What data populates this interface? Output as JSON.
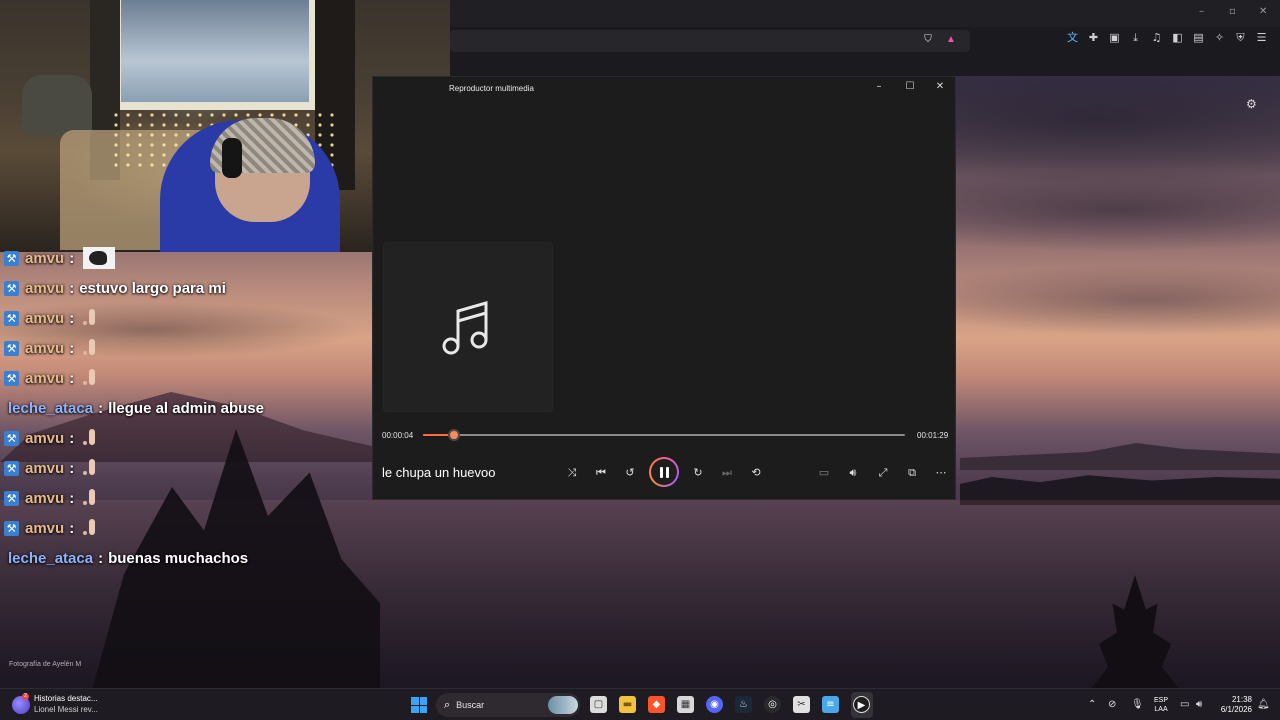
{
  "player": {
    "title": "Reproductor multimedia",
    "song_title": "le chupa un huevoo",
    "time_current": "00:00:04",
    "time_total": "00:01:29",
    "progress_fraction": 0.065,
    "controls": {
      "minimize": "–",
      "maximize": "☐",
      "close": "✕"
    }
  },
  "chat": {
    "messages": [
      {
        "user": "amvu",
        "badge": true,
        "text": "",
        "emote": "thumb"
      },
      {
        "user": "amvu",
        "badge": true,
        "text": "estuvo largo para mi",
        "emote": ""
      },
      {
        "user": "amvu",
        "badge": true,
        "text": "",
        "emote": "small"
      },
      {
        "user": "amvu",
        "badge": true,
        "text": "",
        "emote": "small"
      },
      {
        "user": "amvu",
        "badge": true,
        "text": "",
        "emote": "small"
      },
      {
        "user": "leche_ataca",
        "badge": false,
        "text": "llegue al admin abuse",
        "emote": ""
      },
      {
        "user": "amvu",
        "badge": true,
        "text": "",
        "emote": "small"
      },
      {
        "user": "amvu",
        "badge": true,
        "text": "",
        "emote": "small"
      },
      {
        "user": "amvu",
        "badge": true,
        "text": "",
        "emote": "small"
      },
      {
        "user": "amvu",
        "badge": true,
        "text": "",
        "emote": "small"
      },
      {
        "user": "leche_ataca",
        "badge": false,
        "text": "buenas muchachos",
        "emote": ""
      }
    ],
    "colon": ":"
  },
  "photo_credit": "Fotografía de Ayelén M",
  "taskbar": {
    "widget_title": "Historias destac...",
    "widget_subtitle": "Lionel Messi rev...",
    "widget_badge": "2",
    "search_placeholder": "Buscar",
    "lang_line1": "ESP",
    "lang_line2": "LAA",
    "time": "21:38",
    "date": "6/1/2026"
  },
  "colors": {
    "accent": "#ff6b3b",
    "user_amvu": "#e6b98a",
    "user_leche": "#8fb4ff"
  }
}
